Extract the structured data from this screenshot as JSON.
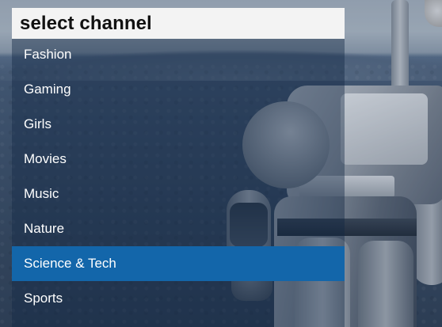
{
  "menu": {
    "title": "select channel",
    "selected_index": 6,
    "items": [
      {
        "label": "Fashion"
      },
      {
        "label": "Gaming"
      },
      {
        "label": "Girls"
      },
      {
        "label": "Movies"
      },
      {
        "label": "Music"
      },
      {
        "label": "Nature"
      },
      {
        "label": "Science & Tech"
      },
      {
        "label": "Sports"
      }
    ]
  },
  "colors": {
    "header_background": "#f3f3f3",
    "selected_item": "#1366aa",
    "item_text": "#ffffff",
    "title_text": "#111111"
  }
}
